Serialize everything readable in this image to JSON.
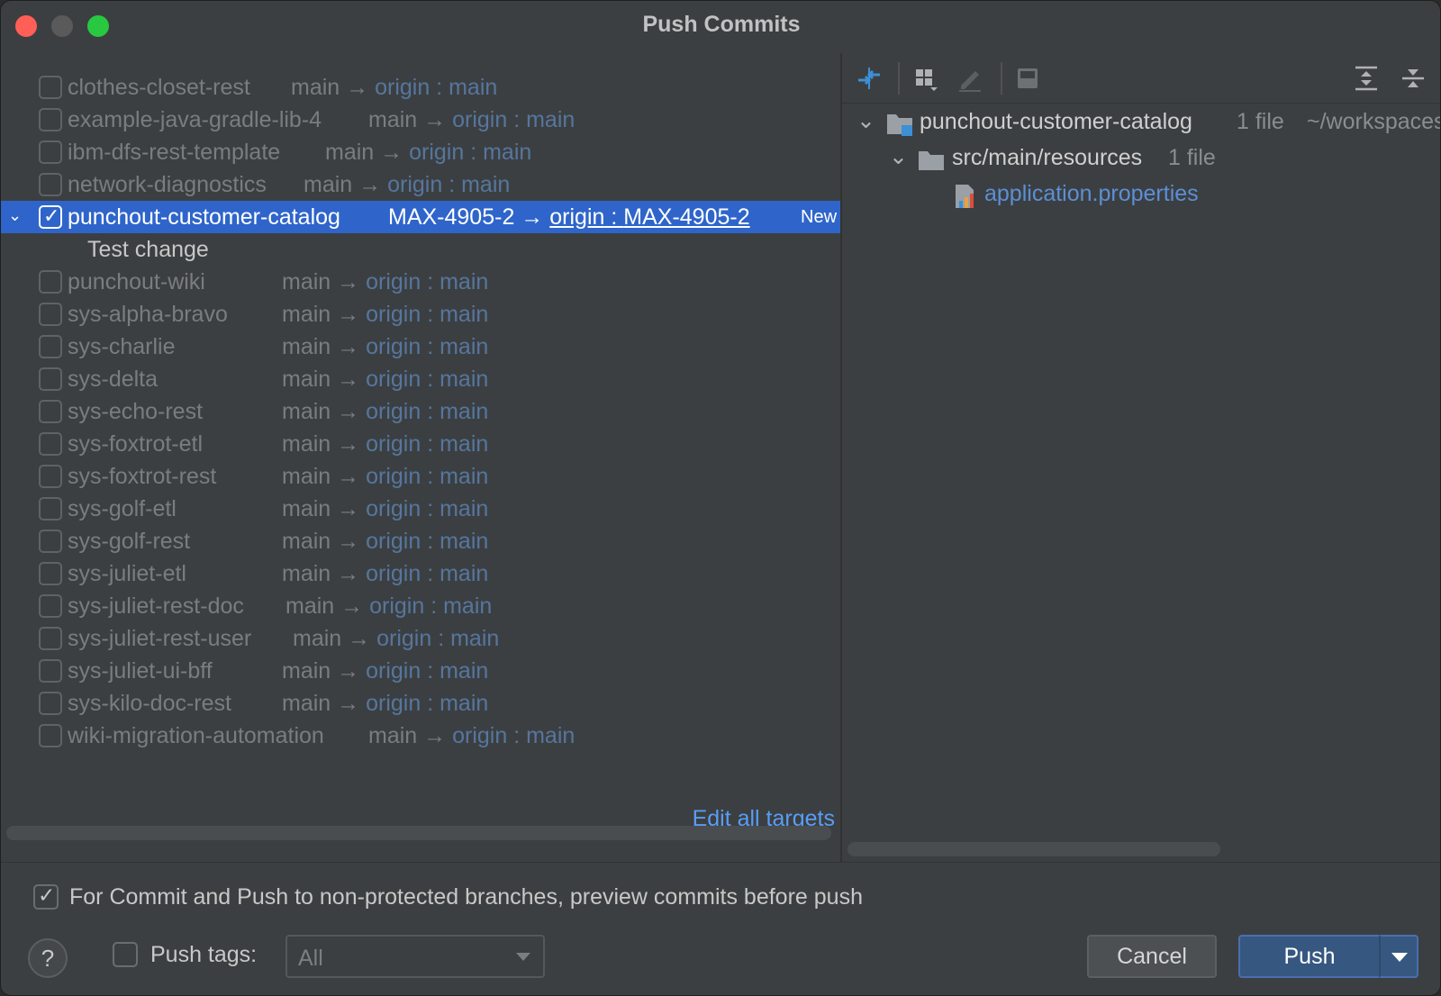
{
  "window": {
    "title": "Push Commits"
  },
  "repos": [
    {
      "name": "clothes-closet-rest",
      "local": "main",
      "remote": "origin",
      "target": "main",
      "checked": false
    },
    {
      "name": "example-java-gradle-lib-4",
      "local": "main",
      "remote": "origin",
      "target": "main",
      "checked": false
    },
    {
      "name": "ibm-dfs-rest-template",
      "local": "main",
      "remote": "origin",
      "target": "main",
      "checked": false
    },
    {
      "name": "network-diagnostics",
      "local": "main",
      "remote": "origin",
      "target": "main",
      "checked": false
    },
    {
      "name": "punchout-customer-catalog",
      "local": "MAX-4905-2",
      "remote": "origin",
      "target": "MAX-4905-2",
      "checked": true,
      "badge": "New",
      "commit": "Test change"
    },
    {
      "name": "punchout-wiki",
      "local": "main",
      "remote": "origin",
      "target": "main",
      "checked": false
    },
    {
      "name": "sys-alpha-bravo",
      "local": "main",
      "remote": "origin",
      "target": "main",
      "checked": false
    },
    {
      "name": "sys-charlie",
      "local": "main",
      "remote": "origin",
      "target": "main",
      "checked": false
    },
    {
      "name": "sys-delta",
      "local": "main",
      "remote": "origin",
      "target": "main",
      "checked": false
    },
    {
      "name": "sys-echo-rest",
      "local": "main",
      "remote": "origin",
      "target": "main",
      "checked": false
    },
    {
      "name": "sys-foxtrot-etl",
      "local": "main",
      "remote": "origin",
      "target": "main",
      "checked": false
    },
    {
      "name": "sys-foxtrot-rest",
      "local": "main",
      "remote": "origin",
      "target": "main",
      "checked": false
    },
    {
      "name": "sys-golf-etl",
      "local": "main",
      "remote": "origin",
      "target": "main",
      "checked": false
    },
    {
      "name": "sys-golf-rest",
      "local": "main",
      "remote": "origin",
      "target": "main",
      "checked": false
    },
    {
      "name": "sys-juliet-etl",
      "local": "main",
      "remote": "origin",
      "target": "main",
      "checked": false
    },
    {
      "name": "sys-juliet-rest-doc",
      "local": "main",
      "remote": "origin",
      "target": "main",
      "checked": false
    },
    {
      "name": "sys-juliet-rest-user",
      "local": "main",
      "remote": "origin",
      "target": "main",
      "checked": false
    },
    {
      "name": "sys-juliet-ui-bff",
      "local": "main",
      "remote": "origin",
      "target": "main",
      "checked": false
    },
    {
      "name": "sys-kilo-doc-rest",
      "local": "main",
      "remote": "origin",
      "target": "main",
      "checked": false
    },
    {
      "name": "wiki-migration-automation",
      "local": "main",
      "remote": "origin",
      "target": "main",
      "checked": false
    }
  ],
  "edit_all_targets": "Edit all targets",
  "changes": {
    "root": {
      "name": "punchout-customer-catalog",
      "count": "1 file",
      "path": "~/workspaces"
    },
    "folder": {
      "name": "src/main/resources",
      "count": "1 file"
    },
    "file": {
      "name": "application.properties"
    }
  },
  "toolbar": {
    "icons": [
      "diff-icon",
      "group-by-icon",
      "edit-source-icon",
      "preview-diff-icon",
      "expand-all-icon",
      "collapse-all-icon"
    ]
  },
  "footer": {
    "preview_label": "For Commit and Push to non-protected branches, preview commits before push",
    "preview_checked": true,
    "help": "?",
    "push_tags_label": "Push tags:",
    "push_tags_value": "All",
    "cancel": "Cancel",
    "push": "Push"
  },
  "colors": {
    "background": "#3c3f41",
    "selection": "#2f65ca",
    "link": "#589df6",
    "primary_button": "#365880"
  }
}
